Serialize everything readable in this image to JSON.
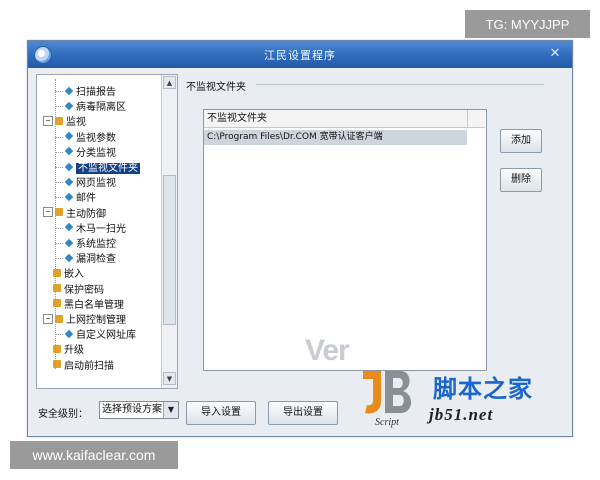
{
  "watermarks": {
    "top": "TG: MYYJJPP",
    "bottom": "www.kaifaclear.com"
  },
  "window": {
    "title": "江民设置程序",
    "close_glyph": "✕"
  },
  "tree": {
    "items": [
      {
        "label": "扫描报告",
        "level": 2,
        "type": "leaf"
      },
      {
        "label": "病毒隔离区",
        "level": 2,
        "type": "leaf"
      },
      {
        "label": "监视",
        "level": 1,
        "type": "branch",
        "expander": "⊟"
      },
      {
        "label": "监视参数",
        "level": 2,
        "type": "leaf"
      },
      {
        "label": "分类监视",
        "level": 2,
        "type": "leaf"
      },
      {
        "label": "不监视文件夹",
        "level": 2,
        "type": "leaf",
        "selected": true
      },
      {
        "label": "网页监视",
        "level": 2,
        "type": "leaf"
      },
      {
        "label": "邮件",
        "level": 2,
        "type": "leaf"
      },
      {
        "label": "主动防御",
        "level": 1,
        "type": "branch",
        "expander": "⊟"
      },
      {
        "label": "木马一扫光",
        "level": 2,
        "type": "leaf"
      },
      {
        "label": "系统监控",
        "level": 2,
        "type": "leaf"
      },
      {
        "label": "漏洞检查",
        "level": 2,
        "type": "leaf"
      },
      {
        "label": "嵌入",
        "level": 1,
        "type": "branch"
      },
      {
        "label": "保护密码",
        "level": 1,
        "type": "branch"
      },
      {
        "label": "黑白名单管理",
        "level": 1,
        "type": "branch"
      },
      {
        "label": "上网控制管理",
        "level": 1,
        "type": "branch",
        "expander": "⊟"
      },
      {
        "label": "自定义网址库",
        "level": 2,
        "type": "leaf"
      },
      {
        "label": "升级",
        "level": 1,
        "type": "branch"
      },
      {
        "label": "启动前扫描",
        "level": 1,
        "type": "branch"
      }
    ],
    "scroll_up": "▲",
    "scroll_down": "▼"
  },
  "panel": {
    "group_title": "不监视文件夹",
    "list_header": "不监视文件夹",
    "rows": [
      "C:\\Program Files\\Dr.COM 宽带认证客户端"
    ],
    "add_button": "添加",
    "delete_button": "删除"
  },
  "bottom": {
    "security_label": "安全级别：",
    "security_select": "选择预设方案",
    "import_button": "导入设置",
    "export_button": "导出设置"
  },
  "logo": {
    "ver_text": "Ver",
    "script_text": "Script",
    "cn_text": "脚本之家",
    "url_text": "jb51.net"
  },
  "colors": {
    "titlebar": "#2f6bbc",
    "selection": "#14408a",
    "logo_blue": "#1a66cc",
    "logo_orange": "#e98a1c"
  }
}
